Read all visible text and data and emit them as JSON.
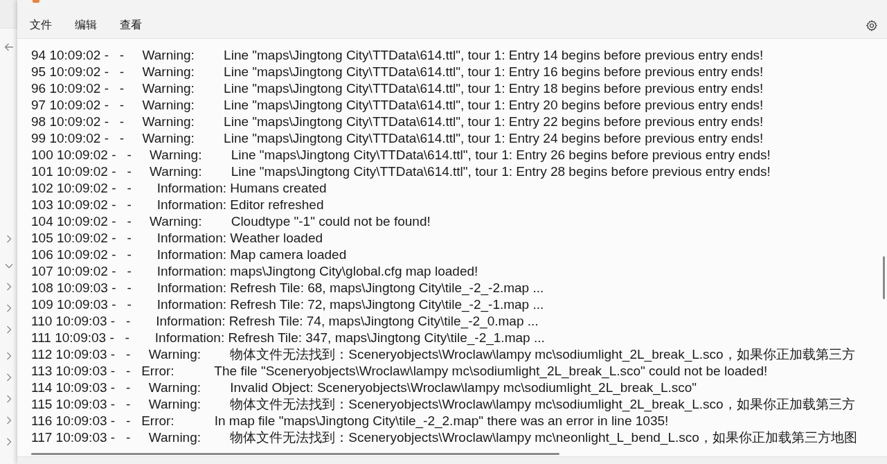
{
  "menu": [
    {
      "label": "文件"
    },
    {
      "label": "编辑"
    },
    {
      "label": "查看"
    }
  ],
  "lines": [
    "94 10:09:02 -   -     Warning:        Line \"maps\\Jingtong City\\TTData\\614.ttl\", tour 1: Entry 14 begins before previous entry ends!",
    "95 10:09:02 -   -     Warning:        Line \"maps\\Jingtong City\\TTData\\614.ttl\", tour 1: Entry 16 begins before previous entry ends!",
    "96 10:09:02 -   -     Warning:        Line \"maps\\Jingtong City\\TTData\\614.ttl\", tour 1: Entry 18 begins before previous entry ends!",
    "97 10:09:02 -   -     Warning:        Line \"maps\\Jingtong City\\TTData\\614.ttl\", tour 1: Entry 20 begins before previous entry ends!",
    "98 10:09:02 -   -     Warning:        Line \"maps\\Jingtong City\\TTData\\614.ttl\", tour 1: Entry 22 begins before previous entry ends!",
    "99 10:09:02 -   -     Warning:        Line \"maps\\Jingtong City\\TTData\\614.ttl\", tour 1: Entry 24 begins before previous entry ends!",
    "100 10:09:02 -   -     Warning:        Line \"maps\\Jingtong City\\TTData\\614.ttl\", tour 1: Entry 26 begins before previous entry ends!",
    "101 10:09:02 -   -     Warning:        Line \"maps\\Jingtong City\\TTData\\614.ttl\", tour 1: Entry 28 begins before previous entry ends!",
    "102 10:09:02 -   -       Information: Humans created",
    "103 10:09:02 -   -       Information: Editor refreshed",
    "104 10:09:02 -   -     Warning:        Cloudtype \"-1\" could not be found!",
    "105 10:09:02 -   -       Information: Weather loaded",
    "106 10:09:02 -   -       Information: Map camera loaded",
    "107 10:09:02 -   -       Information: maps\\Jingtong City\\global.cfg map loaded!",
    "108 10:09:03 -   -       Information: Refresh Tile: 68, maps\\Jingtong City\\tile_-2_-2.map ...",
    "109 10:09:03 -   -       Information: Refresh Tile: 72, maps\\Jingtong City\\tile_-2_-1.map ...",
    "110 10:09:03 -   -       Information: Refresh Tile: 74, maps\\Jingtong City\\tile_-2_0.map ...",
    "111 10:09:03 -   -       Information: Refresh Tile: 347, maps\\Jingtong City\\tile_-2_1.map ...",
    "112 10:09:03 -   -     Warning:        物体文件无法找到：Sceneryobjects\\Wroclaw\\lampy mc\\sodiumlight_2L_break_L.sco，如果你正加载第三方",
    "113 10:09:03 -   -   Error:           The file \"Sceneryobjects\\Wroclaw\\lampy mc\\sodiumlight_2L_break_L.sco\" could not be loaded!",
    "114 10:09:03 -   -     Warning:        Invalid Object: Sceneryobjects\\Wroclaw\\lampy mc\\sodiumlight_2L_break_L.sco\"",
    "115 10:09:03 -   -     Warning:        物体文件无法找到：Sceneryobjects\\Wroclaw\\lampy mc\\sodiumlight_2L_break_L.sco，如果你正加载第三方",
    "116 10:09:03 -   -   Error:           In map file \"maps\\Jingtong City\\tile_-2_2.map\" there was an error in line 1035!",
    "117 10:09:03 -   -     Warning:        物体文件无法找到：Sceneryobjects\\Wroclaw\\lampy mc\\neonlight_L_bend_L.sco，如果你正加载第三方地图"
  ]
}
